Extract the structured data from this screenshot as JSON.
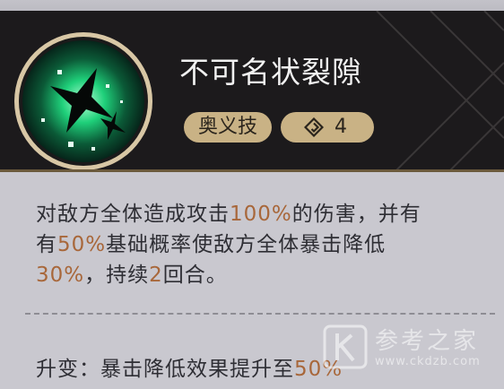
{
  "skill": {
    "name": "不可名状裂隙",
    "type_tag": "奥义技",
    "cost_icon": "diamond-swirl-icon",
    "cost": "4",
    "icon": "green-rift-orb-icon"
  },
  "description": {
    "p1": "对敌方全体造成攻击",
    "v1": "100%",
    "p2": "的伤害，并有",
    "v2": "50%",
    "p3": "基础概率使敌方全体暴击降低",
    "v3": "30%",
    "p4": "，持续",
    "v4": "2",
    "p5": "回合。"
  },
  "upgrade": {
    "label": "升变：",
    "text": "暴击降低效果提升至",
    "value": "50%"
  },
  "watermark": {
    "text": "参考之家",
    "url": "www.ckdzb.com"
  },
  "colors": {
    "header_bg": "#1c1a1c",
    "panel_bg": "#c9c8cf",
    "tag_bg": "#c9b285",
    "highlight": "#a8673a",
    "text": "#2e2e34"
  }
}
